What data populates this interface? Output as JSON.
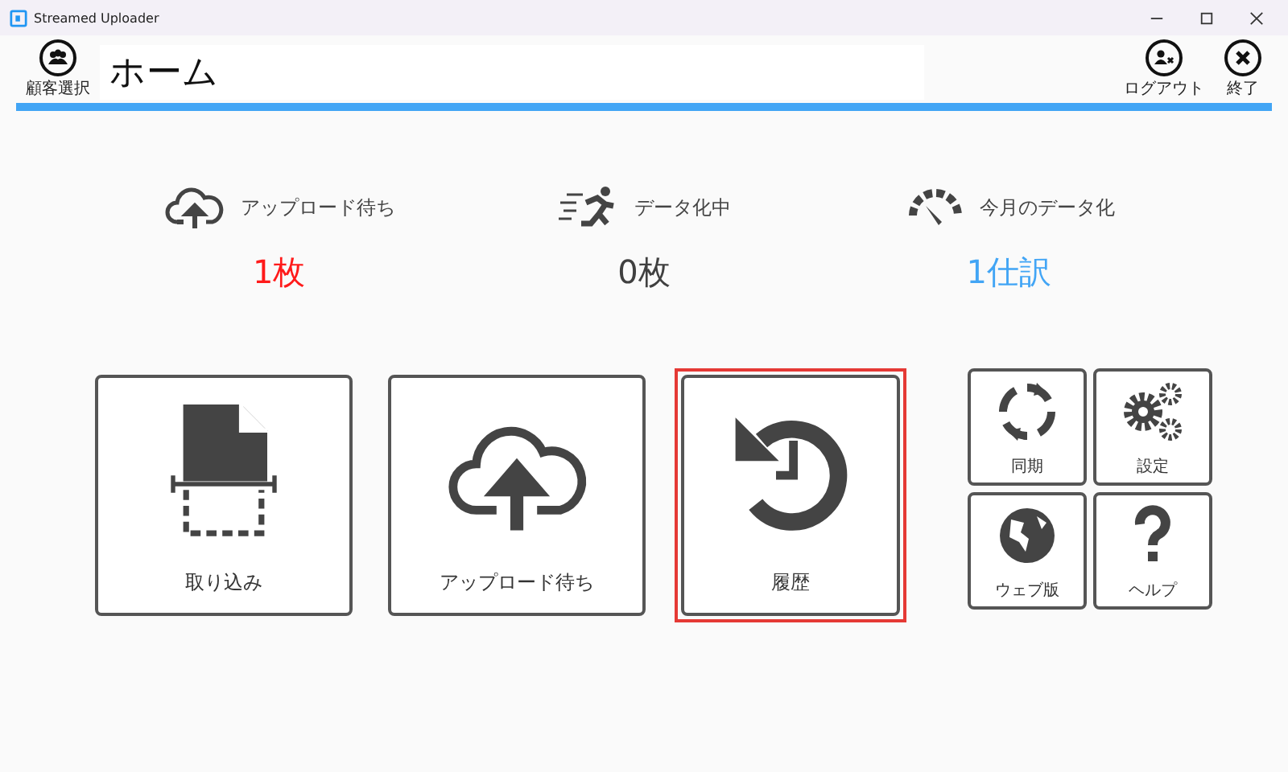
{
  "window": {
    "title": "Streamed Uploader"
  },
  "header": {
    "customer_button": "顧客選択",
    "title": "ホーム",
    "logout_button": "ログアウト",
    "exit_button": "終了"
  },
  "stats": [
    {
      "kind": "upload",
      "label": "アップロード待ち",
      "value": "1枚",
      "color": "#ff1a1a"
    },
    {
      "kind": "running",
      "label": "データ化中",
      "value": "0枚",
      "color": "#404040"
    },
    {
      "kind": "gauge",
      "label": "今月のデータ化",
      "value": "1仕訳",
      "color": "#42a5f5"
    }
  ],
  "tiles": [
    {
      "kind": "scan",
      "label": "取り込み",
      "selected": false
    },
    {
      "kind": "upload",
      "label": "アップロード待ち",
      "selected": false
    },
    {
      "kind": "history",
      "label": "履歴",
      "selected": true
    }
  ],
  "small_tiles": [
    {
      "kind": "sync",
      "label": "同期"
    },
    {
      "kind": "settings",
      "label": "設定"
    },
    {
      "kind": "globe",
      "label": "ウェブ版"
    },
    {
      "kind": "help",
      "label": "ヘルプ"
    }
  ]
}
